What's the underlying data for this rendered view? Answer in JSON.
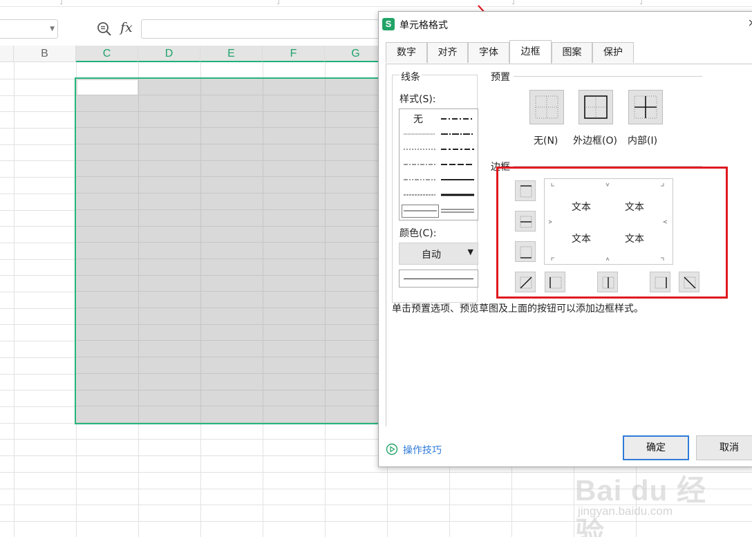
{
  "spreadsheet": {
    "columns": [
      "B",
      "C",
      "D",
      "E",
      "F",
      "G"
    ],
    "formula_icon": "fx",
    "zoom_icon": "zoom-icon"
  },
  "dialog": {
    "title": "单元格格式",
    "app_logo": "S",
    "close_glyph": "×",
    "tabs": [
      {
        "label": "数字",
        "active": false
      },
      {
        "label": "对齐",
        "active": false
      },
      {
        "label": "字体",
        "active": false
      },
      {
        "label": "边框",
        "active": true
      },
      {
        "label": "图案",
        "active": false
      },
      {
        "label": "保护",
        "active": false
      }
    ],
    "line_group": {
      "title": "线条",
      "style_label": "样式(S):",
      "none_label": "无",
      "color_label": "颜色(C):",
      "color_value": "自动"
    },
    "preset_group": {
      "title": "预置",
      "items": [
        {
          "label": "无(N)",
          "icon": "border-none-icon"
        },
        {
          "label": "外边框(O)",
          "icon": "border-outline-icon"
        },
        {
          "label": "内部(I)",
          "icon": "border-inside-icon"
        }
      ]
    },
    "border_group": {
      "title": "边框",
      "preview_text": [
        "文本",
        "文本",
        "文本",
        "文本"
      ]
    },
    "hint": "单击预置选项、预览草图及上面的按钮可以添加边框样式。",
    "tips_link": "操作技巧",
    "ok_label": "确定",
    "cancel_label": "取消"
  },
  "watermark": {
    "logo": "Bai du 经验",
    "url": "jingyan.baidu.com"
  },
  "colors": {
    "selection_border": "#25b57a",
    "annotation_red": "#e0191f",
    "link_blue": "#2f7bd8",
    "app_green": "#21a366"
  }
}
